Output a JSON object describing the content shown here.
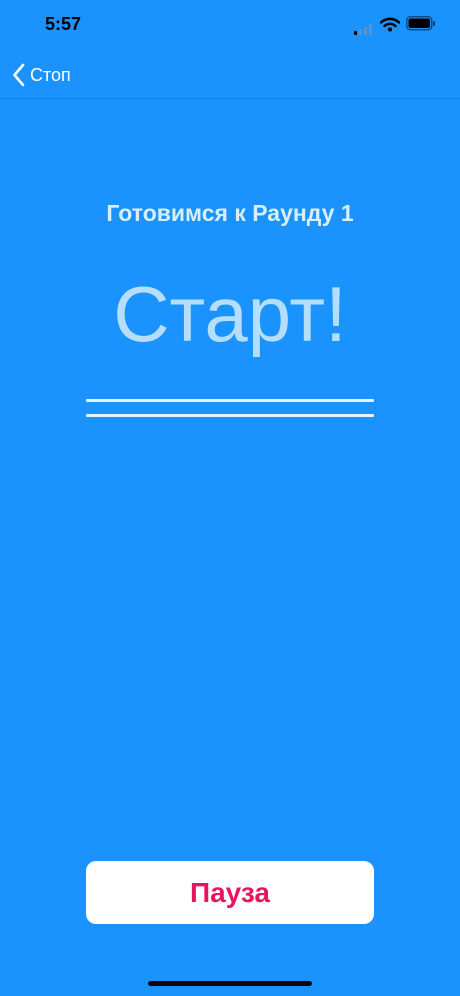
{
  "status_bar": {
    "time": "5:57",
    "icons": [
      "signal-icon",
      "wifi-icon",
      "battery-icon"
    ]
  },
  "nav": {
    "back_label": "Стоп",
    "back_icon": "chevron-left-icon"
  },
  "main": {
    "round_heading": "Готовимся к Раунду 1",
    "countdown": "Старт!"
  },
  "controls": {
    "pause_label": "Пауза"
  },
  "colors": {
    "background": "#1a93fe",
    "accent": "#e8145e",
    "button_bg": "#ffffff"
  }
}
